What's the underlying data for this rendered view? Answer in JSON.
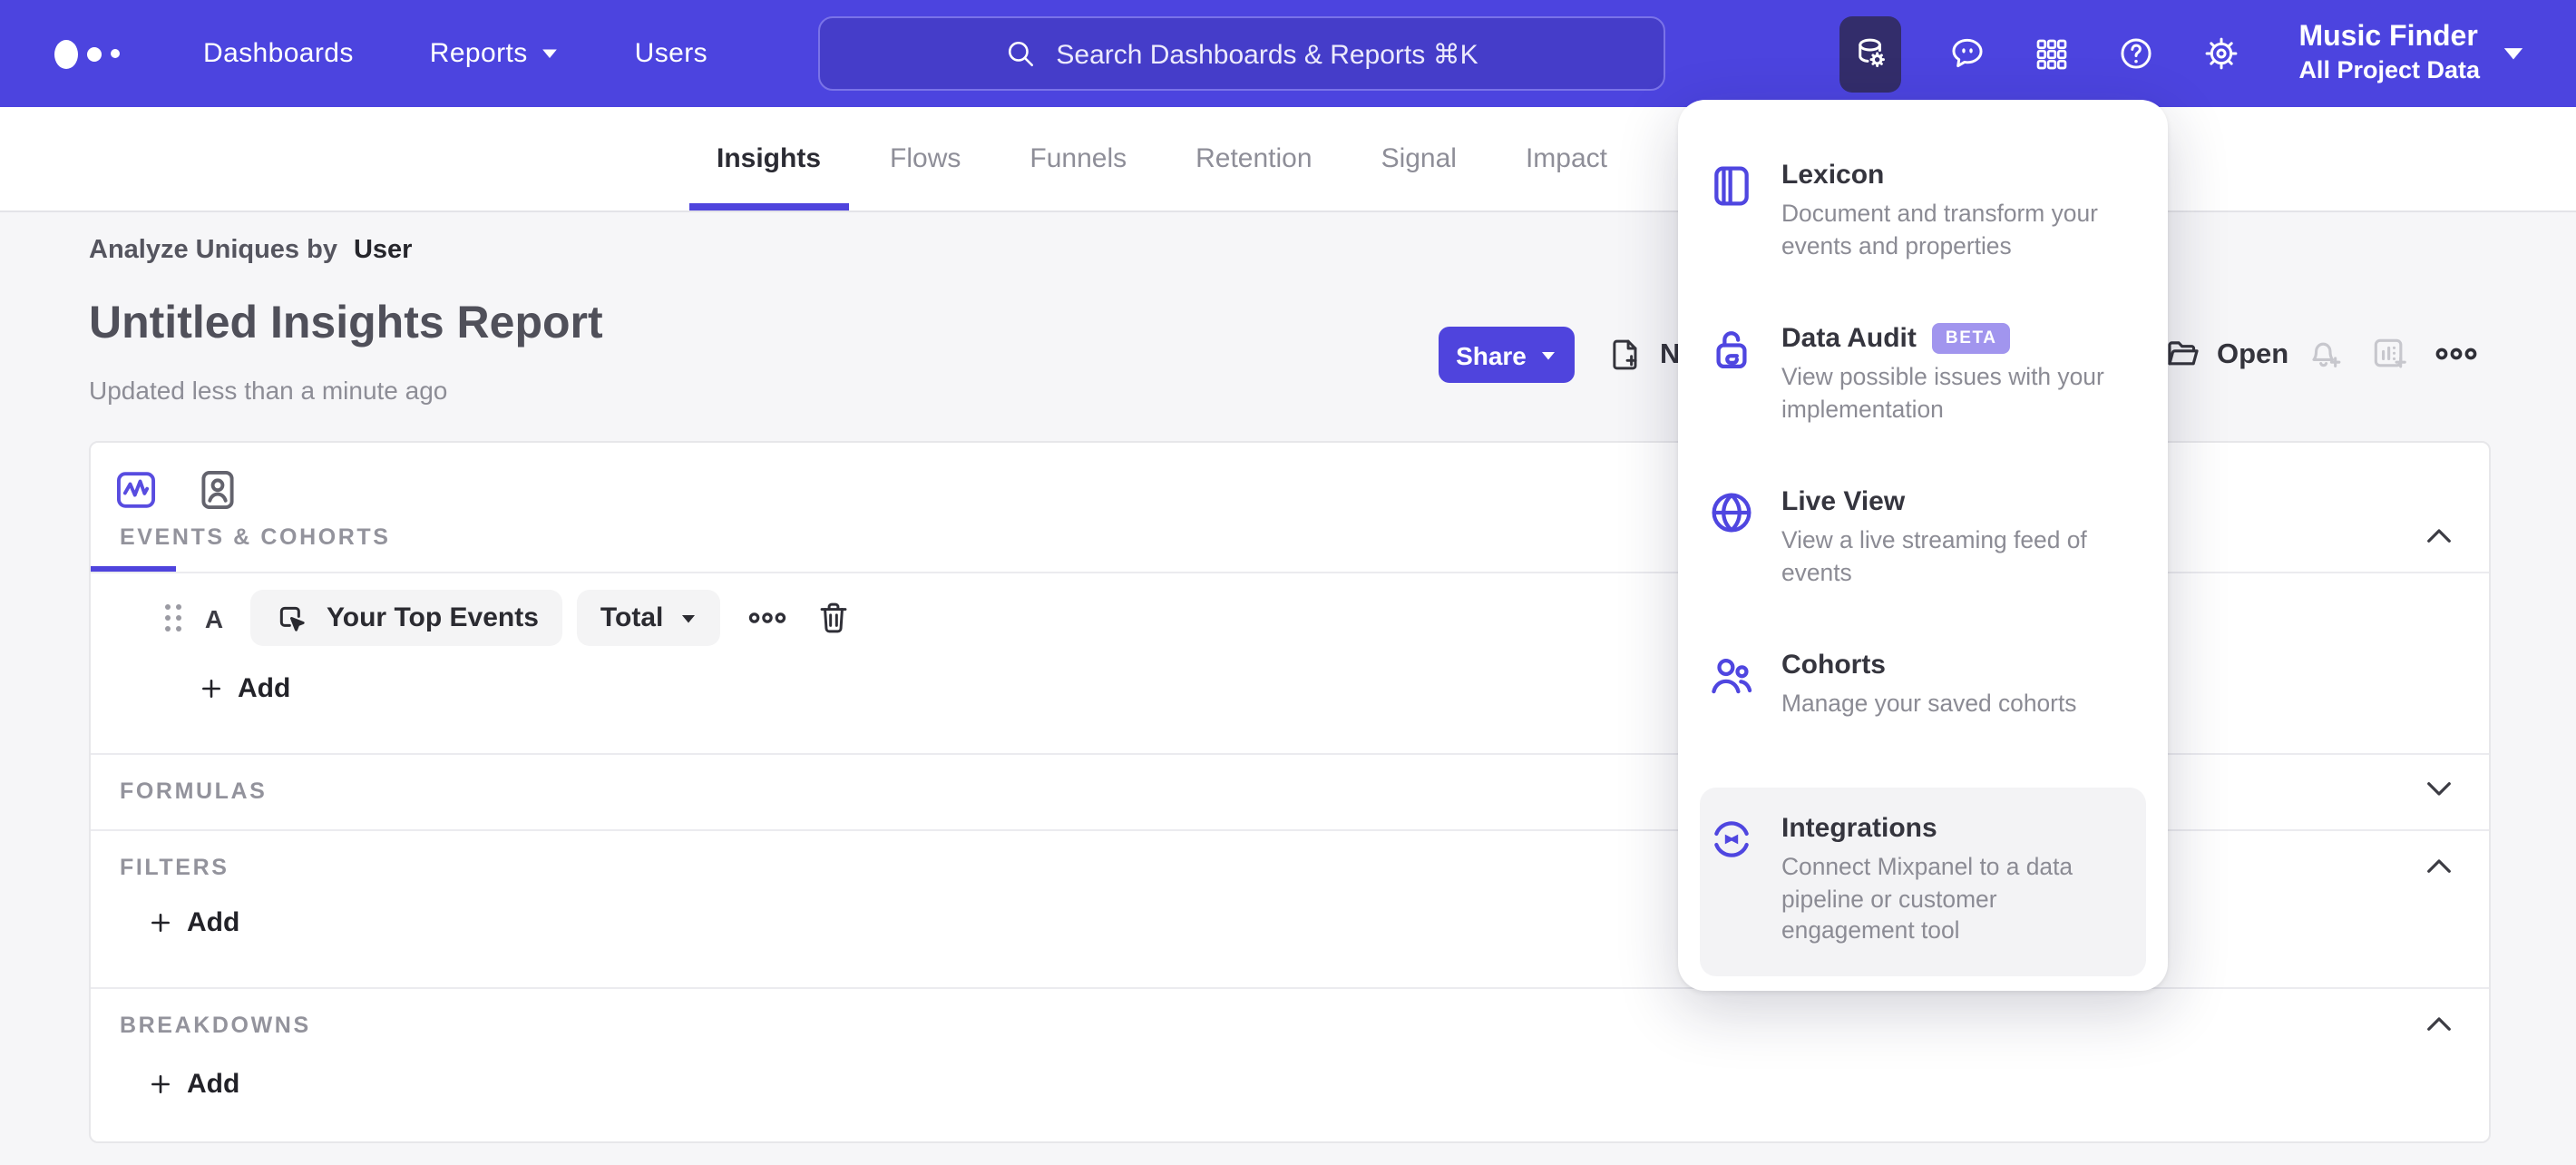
{
  "navbar": {
    "links": [
      {
        "label": "Dashboards"
      },
      {
        "label": "Reports",
        "has_caret": true
      },
      {
        "label": "Users"
      }
    ],
    "search": {
      "placeholder": "Search Dashboards & Reports ⌘K"
    },
    "icons": [
      "data-management-icon",
      "feedback-bubble-icon",
      "apps-grid-icon",
      "help-icon",
      "gear-icon"
    ],
    "project": {
      "name": "Music Finder",
      "scope": "All Project Data"
    }
  },
  "tabs": [
    {
      "label": "Insights",
      "active": true
    },
    {
      "label": "Flows"
    },
    {
      "label": "Funnels"
    },
    {
      "label": "Retention"
    },
    {
      "label": "Signal"
    },
    {
      "label": "Impact"
    }
  ],
  "header": {
    "analyze_prefix": "Analyze Uniques by",
    "analyze_value": "User",
    "title": "Untitled Insights Report",
    "updated": "Updated less than a minute ago"
  },
  "toolbar": {
    "share": "Share",
    "new": "New",
    "open": "Open"
  },
  "builder": {
    "events_label": "EVENTS & COHORTS",
    "row": {
      "letter": "A",
      "event": "Your Top Events",
      "metric": "Total"
    },
    "add_label": "Add",
    "formulas_label": "FORMULAS",
    "filters_label": "FILTERS",
    "breakdowns_label": "BREAKDOWNS"
  },
  "menu": {
    "items": [
      {
        "title": "Lexicon",
        "desc": "Document and transform your events and properties",
        "icon": "book-icon"
      },
      {
        "title": "Data Audit",
        "badge": "BETA",
        "desc": "View possible issues with your implementation",
        "icon": "lock-icon"
      },
      {
        "title": "Live View",
        "desc": "View a live streaming feed of events",
        "icon": "globe-icon"
      },
      {
        "title": "Cohorts",
        "desc": "Manage your saved cohorts",
        "icon": "people-icon"
      },
      {
        "title": "Integrations",
        "desc": "Connect Mixpanel to a data pipeline or customer engagement tool",
        "icon": "sync-arrows-icon",
        "highlighted": true
      }
    ]
  },
  "colors": {
    "accent": "#4f44dd",
    "navbar": "#4c44df",
    "navbar_active_tile": "#332d6b",
    "search_field": "#453dc9",
    "page_background": "#f6f6f8",
    "beta_badge": "#a195ee"
  }
}
